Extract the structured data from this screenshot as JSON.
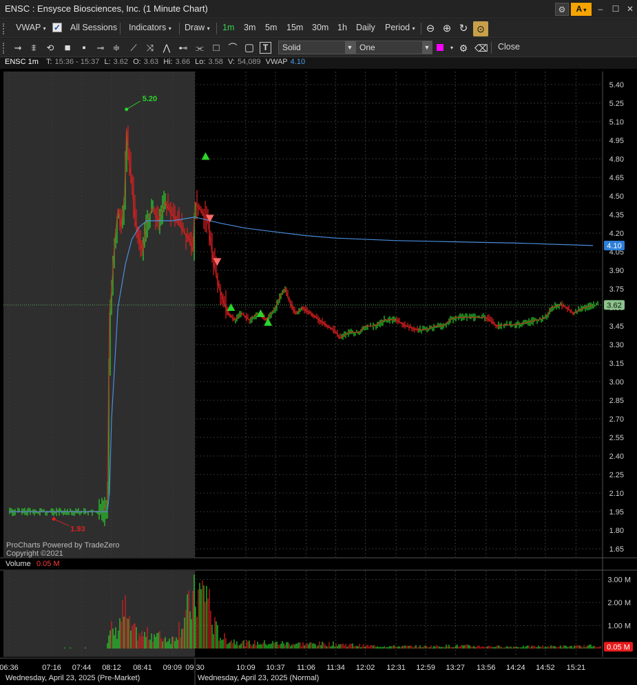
{
  "window": {
    "title": "ENSC : Ensysce Biosciences, Inc. (1 Minute Chart)",
    "gear_icon": "gear-icon",
    "alert_label": "A",
    "minimize": "minimize-icon",
    "maximize": "maximize-icon",
    "close": "close-icon"
  },
  "toolbar1": {
    "vwap": "VWAP",
    "all_sessions": "All Sessions",
    "indicators": "Indicators",
    "draw": "Draw",
    "intervals": [
      "1m",
      "3m",
      "5m",
      "15m",
      "30m",
      "1h",
      "Daily"
    ],
    "period": "Period"
  },
  "toolbar2": {
    "line_style": "Solid",
    "line_count": "One",
    "close": "Close"
  },
  "info": {
    "symbol": "ENSC 1m",
    "t_label": "T:",
    "t_value": "15:36 - 15:37",
    "l_label": "L:",
    "l_value": "3.62",
    "o_label": "O:",
    "o_value": "3.63",
    "hi_label": "Hi:",
    "hi_value": "3.66",
    "lo_label": "Lo:",
    "lo_value": "3.58",
    "v_label": "V:",
    "v_value": "54,089",
    "vwap_label": "VWAP",
    "vwap_value": "4.10"
  },
  "chart_data": {
    "type": "line",
    "title": "ENSC : Ensysce Biosciences, Inc. (1 Minute Chart)",
    "price_axis": [
      "5.40",
      "5.25",
      "5.10",
      "4.95",
      "4.80",
      "4.65",
      "4.50",
      "4.35",
      "4.20",
      "4.05",
      "3.90",
      "3.75",
      "3.60",
      "3.45",
      "3.30",
      "3.15",
      "3.00",
      "2.85",
      "2.70",
      "2.55",
      "2.40",
      "2.25",
      "2.10",
      "1.95",
      "1.80",
      "1.65"
    ],
    "volume_axis": [
      "3.00 M",
      "2.00 M",
      "1.00 M"
    ],
    "time_axis": [
      "06:36",
      "07:16",
      "07:44",
      "08:12",
      "08:41",
      "09:09",
      "09:30",
      "10:09",
      "10:37",
      "11:06",
      "11:34",
      "12:02",
      "12:31",
      "12:59",
      "13:27",
      "13:56",
      "14:24",
      "14:52",
      "15:21"
    ],
    "premarket_label": "Wednesday, April 23, 2025 (Pre-Market)",
    "normal_label": "Wednesday, April 23, 2025 (Normal)",
    "high_marker": "5.20",
    "low_marker": "1.93",
    "last_price_tag": "3.62",
    "vwap_tag": "4.10",
    "volume_label": "Volume",
    "volume_value": "0.05 M",
    "volume_tag": "0.05 M",
    "watermark": [
      "ProCharts Powered by TradeZero",
      "Copyright ©2021"
    ],
    "price_series": [
      [
        "06:36",
        1.95
      ],
      [
        "07:16",
        1.95
      ],
      [
        "07:44",
        1.95
      ],
      [
        "08:05",
        1.95
      ],
      [
        "08:08",
        2.05
      ],
      [
        "08:10",
        3.55
      ],
      [
        "08:12",
        3.75
      ],
      [
        "08:15",
        4.15
      ],
      [
        "08:18",
        4.4
      ],
      [
        "08:21",
        4.25
      ],
      [
        "08:24",
        4.5
      ],
      [
        "08:26",
        5.05
      ],
      [
        "08:28",
        4.8
      ],
      [
        "08:31",
        4.6
      ],
      [
        "08:34",
        4.3
      ],
      [
        "08:38",
        4.15
      ],
      [
        "08:41",
        4.05
      ],
      [
        "08:45",
        4.3
      ],
      [
        "08:50",
        4.4
      ],
      [
        "08:56",
        4.3
      ],
      [
        "09:02",
        4.45
      ],
      [
        "09:08",
        4.35
      ],
      [
        "09:14",
        4.3
      ],
      [
        "09:20",
        4.2
      ],
      [
        "09:25",
        4.15
      ],
      [
        "09:28",
        4.05
      ],
      [
        "09:30",
        4.45
      ],
      [
        "09:33",
        4.3
      ],
      [
        "09:36",
        4.1
      ],
      [
        "09:40",
        3.9
      ],
      [
        "09:44",
        3.75
      ],
      [
        "09:48",
        3.65
      ],
      [
        "09:52",
        3.55
      ],
      [
        "09:58",
        3.5
      ],
      [
        "10:05",
        3.55
      ],
      [
        "10:12",
        3.5
      ],
      [
        "10:20",
        3.55
      ],
      [
        "10:28",
        3.5
      ],
      [
        "10:37",
        3.6
      ],
      [
        "10:42",
        3.7
      ],
      [
        "10:46",
        3.75
      ],
      [
        "10:50",
        3.65
      ],
      [
        "10:56",
        3.55
      ],
      [
        "11:02",
        3.6
      ],
      [
        "11:10",
        3.55
      ],
      [
        "11:18",
        3.5
      ],
      [
        "11:26",
        3.45
      ],
      [
        "11:34",
        3.4
      ],
      [
        "11:38",
        3.35
      ],
      [
        "11:46",
        3.4
      ],
      [
        "11:56",
        3.4
      ],
      [
        "12:02",
        3.45
      ],
      [
        "12:10",
        3.45
      ],
      [
        "12:20",
        3.5
      ],
      [
        "12:31",
        3.5
      ],
      [
        "12:40",
        3.45
      ],
      [
        "12:50",
        3.42
      ],
      [
        "12:59",
        3.42
      ],
      [
        "13:08",
        3.45
      ],
      [
        "13:15",
        3.45
      ],
      [
        "13:22",
        3.5
      ],
      [
        "13:27",
        3.52
      ],
      [
        "13:40",
        3.52
      ],
      [
        "13:56",
        3.52
      ],
      [
        "14:06",
        3.45
      ],
      [
        "14:15",
        3.46
      ],
      [
        "14:24",
        3.46
      ],
      [
        "14:35",
        3.48
      ],
      [
        "14:45",
        3.5
      ],
      [
        "14:52",
        3.52
      ],
      [
        "14:58",
        3.6
      ],
      [
        "15:06",
        3.62
      ],
      [
        "15:12",
        3.6
      ],
      [
        "15:18",
        3.55
      ],
      [
        "15:24",
        3.58
      ],
      [
        "15:30",
        3.6
      ],
      [
        "15:37",
        3.62
      ]
    ],
    "vwap_series": [
      [
        "06:36",
        1.95
      ],
      [
        "08:08",
        1.95
      ],
      [
        "08:10",
        2.1
      ],
      [
        "08:12",
        2.7
      ],
      [
        "08:18",
        3.6
      ],
      [
        "08:25",
        3.95
      ],
      [
        "08:31",
        4.15
      ],
      [
        "08:38",
        4.25
      ],
      [
        "08:45",
        4.3
      ],
      [
        "09:09",
        4.3
      ],
      [
        "09:30",
        4.33
      ],
      [
        "09:45",
        4.28
      ],
      [
        "10:09",
        4.24
      ],
      [
        "10:37",
        4.21
      ],
      [
        "11:06",
        4.18
      ],
      [
        "11:34",
        4.16
      ],
      [
        "12:31",
        4.14
      ],
      [
        "13:27",
        4.13
      ],
      [
        "14:24",
        4.12
      ],
      [
        "15:37",
        4.1
      ]
    ],
    "volume_series": [
      [
        "08:08",
        0.3
      ],
      [
        "08:12",
        1.0
      ],
      [
        "08:16",
        0.8
      ],
      [
        "08:21",
        1.7
      ],
      [
        "08:25",
        2.0
      ],
      [
        "08:28",
        1.2
      ],
      [
        "08:33",
        0.9
      ],
      [
        "08:41",
        0.7
      ],
      [
        "08:50",
        0.8
      ],
      [
        "09:00",
        0.6
      ],
      [
        "09:09",
        0.5
      ],
      [
        "09:30",
        2.7
      ],
      [
        "09:33",
        3.2
      ],
      [
        "09:37",
        1.5
      ],
      [
        "09:41",
        1.0
      ],
      [
        "09:45",
        0.7
      ],
      [
        "09:50",
        0.5
      ],
      [
        "10:00",
        0.4
      ],
      [
        "10:09",
        0.3
      ],
      [
        "10:37",
        0.3
      ],
      [
        "11:06",
        0.25
      ],
      [
        "11:34",
        0.25
      ],
      [
        "12:02",
        0.15
      ],
      [
        "12:31",
        0.12
      ],
      [
        "12:59",
        0.12
      ],
      [
        "13:27",
        0.15
      ],
      [
        "13:56",
        0.12
      ],
      [
        "14:24",
        0.1
      ],
      [
        "14:52",
        0.12
      ],
      [
        "15:21",
        0.12
      ],
      [
        "15:37",
        0.15
      ]
    ],
    "buy_markers": [
      [
        "09:31",
        4.82
      ],
      [
        "09:55",
        3.6
      ],
      [
        "10:23",
        3.55
      ],
      [
        "10:30",
        3.48
      ]
    ],
    "sell_markers": [
      [
        "09:35",
        4.32
      ],
      [
        "09:42",
        3.97
      ]
    ]
  }
}
